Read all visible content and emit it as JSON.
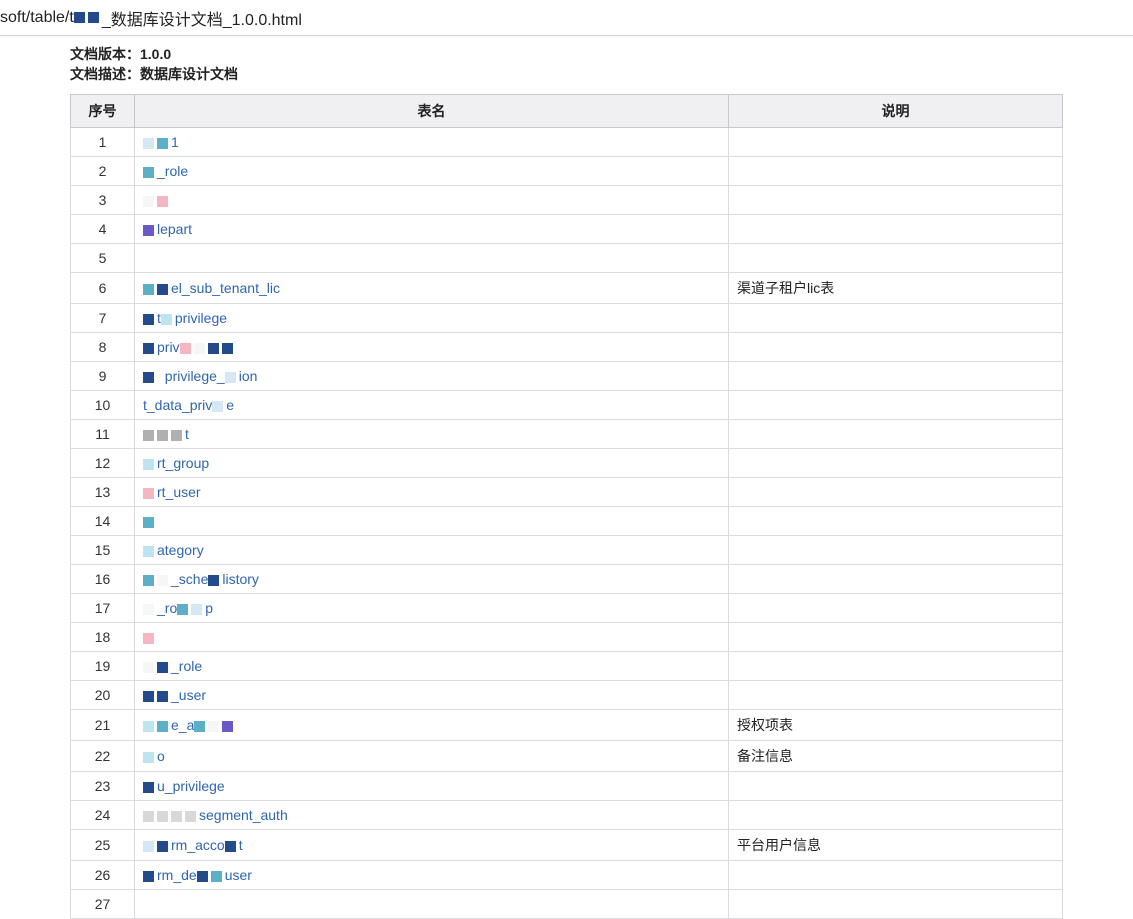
{
  "addressbar": {
    "url_prefix": "soft/table/t",
    "url_suffix": "_数据库设计文档_1.0.0.html"
  },
  "meta": {
    "version_label": "文档版本：",
    "version_value": "1.0.0",
    "desc_label": "文档描述：",
    "desc_value": "数据库设计文档"
  },
  "columns": {
    "idx": "序号",
    "name": "表名",
    "desc": "说明"
  },
  "rows": [
    {
      "idx": "1",
      "frags": [
        {
          "t": "px",
          "k": [
            "lblue",
            "teal"
          ]
        },
        {
          "t": "txt",
          "v": "1"
        }
      ],
      "desc": ""
    },
    {
      "idx": "2",
      "frags": [
        {
          "t": "px",
          "k": [
            "teal"
          ]
        },
        {
          "t": "txt",
          "v": "_role"
        }
      ],
      "desc": ""
    },
    {
      "idx": "3",
      "frags": [
        {
          "t": "px",
          "k": [
            "white",
            "pink"
          ]
        }
      ],
      "desc": ""
    },
    {
      "idx": "4",
      "frags": [
        {
          "t": "px",
          "k": [
            "purple"
          ]
        },
        {
          "t": "txt",
          "v": "lepart"
        }
      ],
      "desc": ""
    },
    {
      "idx": "5",
      "frags": [
        {
          "t": "px",
          "k": []
        }
      ],
      "desc": ""
    },
    {
      "idx": "6",
      "frags": [
        {
          "t": "px",
          "k": [
            "teal",
            "navy"
          ]
        },
        {
          "t": "txt",
          "v": "el_sub_tenant_lic"
        }
      ],
      "desc": "渠道子租户lic表"
    },
    {
      "idx": "7",
      "frags": [
        {
          "t": "px",
          "k": [
            "navy"
          ]
        },
        {
          "t": "txt",
          "v": "t"
        },
        {
          "t": "px",
          "k": [
            "cyan"
          ]
        },
        {
          "t": "txt",
          "v": "privilege"
        }
      ],
      "desc": ""
    },
    {
      "idx": "8",
      "frags": [
        {
          "t": "px",
          "k": [
            "navy"
          ]
        },
        {
          "t": "txt",
          "v": "priv"
        },
        {
          "t": "px",
          "k": [
            "pink",
            "white",
            "navy",
            "navy"
          ]
        }
      ],
      "desc": ""
    },
    {
      "idx": "9",
      "frags": [
        {
          "t": "px",
          "k": [
            "navy"
          ]
        },
        {
          "t": "sp"
        },
        {
          "t": "txt",
          "v": "privilege_"
        },
        {
          "t": "px",
          "k": [
            "lblue"
          ]
        },
        {
          "t": "txt",
          "v": "ion"
        }
      ],
      "desc": ""
    },
    {
      "idx": "10",
      "frags": [
        {
          "t": "px",
          "k": []
        },
        {
          "t": "txt",
          "v": "t_data_priv"
        },
        {
          "t": "px",
          "k": [
            "lblue"
          ]
        },
        {
          "t": "txt",
          "v": "e"
        }
      ],
      "desc": ""
    },
    {
      "idx": "11",
      "frags": [
        {
          "t": "px",
          "k": [
            "gray",
            "gray",
            "gray"
          ]
        },
        {
          "t": "txt",
          "v": "t"
        }
      ],
      "desc": ""
    },
    {
      "idx": "12",
      "frags": [
        {
          "t": "px",
          "k": [
            "cyan"
          ]
        },
        {
          "t": "txt",
          "v": "rt_group"
        }
      ],
      "desc": ""
    },
    {
      "idx": "13",
      "frags": [
        {
          "t": "px",
          "k": [
            "pink"
          ]
        },
        {
          "t": "txt",
          "v": "rt_user"
        }
      ],
      "desc": ""
    },
    {
      "idx": "14",
      "frags": [
        {
          "t": "px",
          "k": [
            "teal"
          ]
        }
      ],
      "desc": ""
    },
    {
      "idx": "15",
      "frags": [
        {
          "t": "px",
          "k": [
            "cyan"
          ]
        },
        {
          "t": "txt",
          "v": "ategory"
        }
      ],
      "desc": ""
    },
    {
      "idx": "16",
      "frags": [
        {
          "t": "px",
          "k": [
            "teal",
            "white"
          ]
        },
        {
          "t": "txt",
          "v": "_sche"
        },
        {
          "t": "px",
          "k": [
            "navy"
          ]
        },
        {
          "t": "txt",
          "v": "listory"
        }
      ],
      "desc": ""
    },
    {
      "idx": "17",
      "frags": [
        {
          "t": "px",
          "k": [
            "white"
          ]
        },
        {
          "t": "txt",
          "v": "_ro"
        },
        {
          "t": "px",
          "k": [
            "teal",
            "lblue"
          ]
        },
        {
          "t": "txt",
          "v": "p"
        }
      ],
      "desc": ""
    },
    {
      "idx": "18",
      "frags": [
        {
          "t": "px",
          "k": [
            "pink"
          ]
        }
      ],
      "desc": ""
    },
    {
      "idx": "19",
      "frags": [
        {
          "t": "px",
          "k": [
            "white",
            "navy"
          ]
        },
        {
          "t": "txt",
          "v": "_role"
        }
      ],
      "desc": ""
    },
    {
      "idx": "20",
      "frags": [
        {
          "t": "px",
          "k": [
            "navy",
            "navy"
          ]
        },
        {
          "t": "txt",
          "v": "_user"
        }
      ],
      "desc": ""
    },
    {
      "idx": "21",
      "frags": [
        {
          "t": "px",
          "k": [
            "cyan",
            "teal"
          ]
        },
        {
          "t": "txt",
          "v": "e_a"
        },
        {
          "t": "px",
          "k": [
            "teal",
            "white",
            "purple"
          ]
        }
      ],
      "desc": "授权项表"
    },
    {
      "idx": "22",
      "frags": [
        {
          "t": "px",
          "k": [
            "cyan"
          ]
        },
        {
          "t": "txt",
          "v": "o"
        }
      ],
      "desc": "备注信息"
    },
    {
      "idx": "23",
      "frags": [
        {
          "t": "px",
          "k": [
            "navy"
          ]
        },
        {
          "t": "txt",
          "v": "u_privilege"
        }
      ],
      "desc": ""
    },
    {
      "idx": "24",
      "frags": [
        {
          "t": "px",
          "k": [
            "lgray",
            "lgray",
            "lgray",
            "lgray"
          ]
        },
        {
          "t": "txt",
          "v": "segment_auth"
        }
      ],
      "desc": ""
    },
    {
      "idx": "25",
      "frags": [
        {
          "t": "px",
          "k": [
            "lblue",
            "navy"
          ]
        },
        {
          "t": "txt",
          "v": "rm_acco"
        },
        {
          "t": "px",
          "k": [
            "navy"
          ]
        },
        {
          "t": "txt",
          "v": "t"
        }
      ],
      "desc": "平台用户信息"
    },
    {
      "idx": "26",
      "frags": [
        {
          "t": "px",
          "k": [
            "navy"
          ]
        },
        {
          "t": "txt",
          "v": "rm_de"
        },
        {
          "t": "px",
          "k": [
            "navy",
            "teal"
          ]
        },
        {
          "t": "txt",
          "v": "user"
        }
      ],
      "desc": ""
    }
  ],
  "next_idx": "27"
}
